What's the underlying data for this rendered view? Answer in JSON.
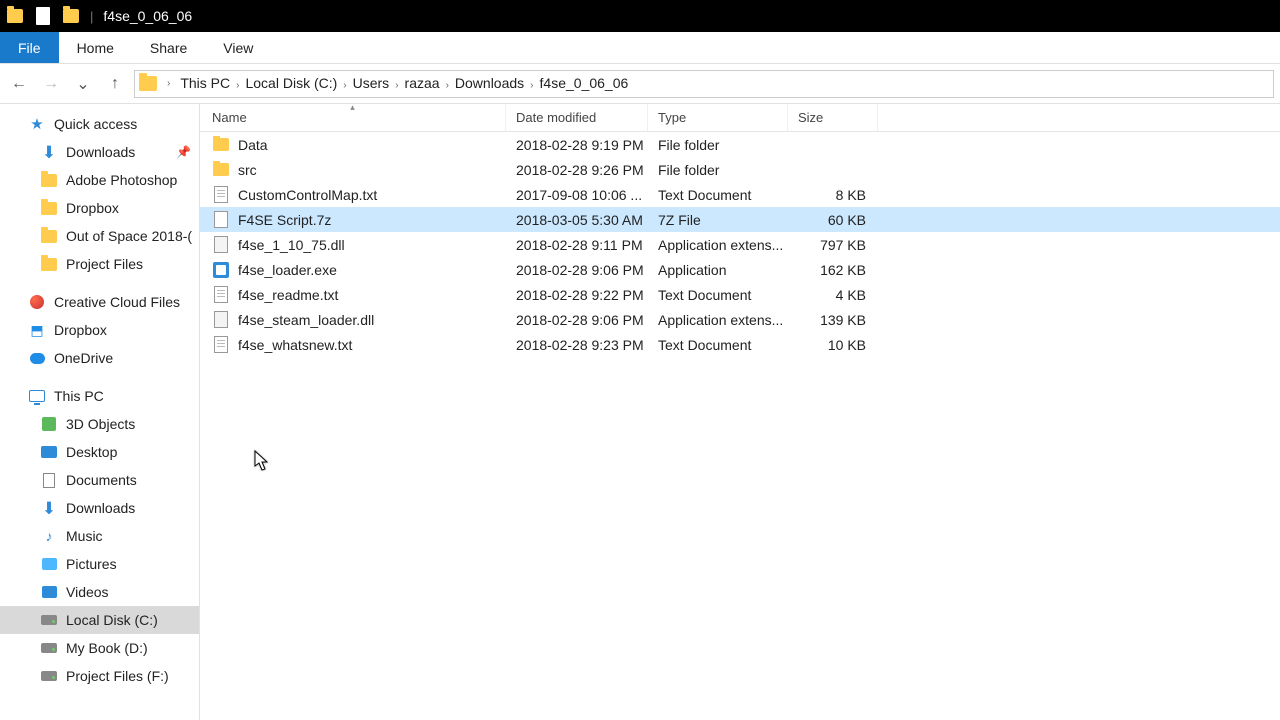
{
  "window": {
    "title": "f4se_0_06_06"
  },
  "ribbon": {
    "file": "File",
    "home": "Home",
    "share": "Share",
    "view": "View"
  },
  "nav": {
    "back": "←",
    "forward": "→",
    "recent": "⌄",
    "up": "↑"
  },
  "breadcrumb": [
    "This PC",
    "Local Disk (C:)",
    "Users",
    "razaa",
    "Downloads",
    "f4se_0_06_06"
  ],
  "headers": {
    "name": "Name",
    "date": "Date modified",
    "type": "Type",
    "size": "Size"
  },
  "files": [
    {
      "icon": "folder",
      "name": "Data",
      "date": "2018-02-28 9:19 PM",
      "type": "File folder",
      "size": ""
    },
    {
      "icon": "folder",
      "name": "src",
      "date": "2018-02-28 9:26 PM",
      "type": "File folder",
      "size": ""
    },
    {
      "icon": "txt",
      "name": "CustomControlMap.txt",
      "date": "2017-09-08 10:06 ...",
      "type": "Text Document",
      "size": "8 KB"
    },
    {
      "icon": "7z",
      "name": "F4SE Script.7z",
      "date": "2018-03-05 5:30 AM",
      "type": "7Z File",
      "size": "60 KB",
      "selected": true
    },
    {
      "icon": "dll",
      "name": "f4se_1_10_75.dll",
      "date": "2018-02-28 9:11 PM",
      "type": "Application extens...",
      "size": "797 KB"
    },
    {
      "icon": "exe",
      "name": "f4se_loader.exe",
      "date": "2018-02-28 9:06 PM",
      "type": "Application",
      "size": "162 KB"
    },
    {
      "icon": "txt",
      "name": "f4se_readme.txt",
      "date": "2018-02-28 9:22 PM",
      "type": "Text Document",
      "size": "4 KB"
    },
    {
      "icon": "dll",
      "name": "f4se_steam_loader.dll",
      "date": "2018-02-28 9:06 PM",
      "type": "Application extens...",
      "size": "139 KB"
    },
    {
      "icon": "txt",
      "name": "f4se_whatsnew.txt",
      "date": "2018-02-28 9:23 PM",
      "type": "Text Document",
      "size": "10 KB"
    }
  ],
  "sidebar": {
    "quick": {
      "label": "Quick access",
      "items": [
        {
          "label": "Downloads",
          "icon": "dl",
          "pinned": true
        },
        {
          "label": "Adobe Photoshop",
          "icon": "folder"
        },
        {
          "label": "Dropbox",
          "icon": "folder"
        },
        {
          "label": "Out of Space 2018-(",
          "icon": "folder"
        },
        {
          "label": "Project Files",
          "icon": "folder"
        }
      ]
    },
    "roots": [
      {
        "label": "Creative Cloud Files",
        "icon": "cc"
      },
      {
        "label": "Dropbox",
        "icon": "dbx"
      },
      {
        "label": "OneDrive",
        "icon": "od"
      }
    ],
    "pc": {
      "label": "This PC",
      "items": [
        {
          "label": "3D Objects",
          "icon": "3d"
        },
        {
          "label": "Desktop",
          "icon": "mon"
        },
        {
          "label": "Documents",
          "icon": "doc2"
        },
        {
          "label": "Downloads",
          "icon": "dl"
        },
        {
          "label": "Music",
          "icon": "mus"
        },
        {
          "label": "Pictures",
          "icon": "pic"
        },
        {
          "label": "Videos",
          "icon": "vid"
        },
        {
          "label": "Local Disk (C:)",
          "icon": "drv",
          "selected": true
        },
        {
          "label": "My Book (D:)",
          "icon": "drv"
        },
        {
          "label": "Project Files (F:)",
          "icon": "drv"
        }
      ]
    }
  }
}
